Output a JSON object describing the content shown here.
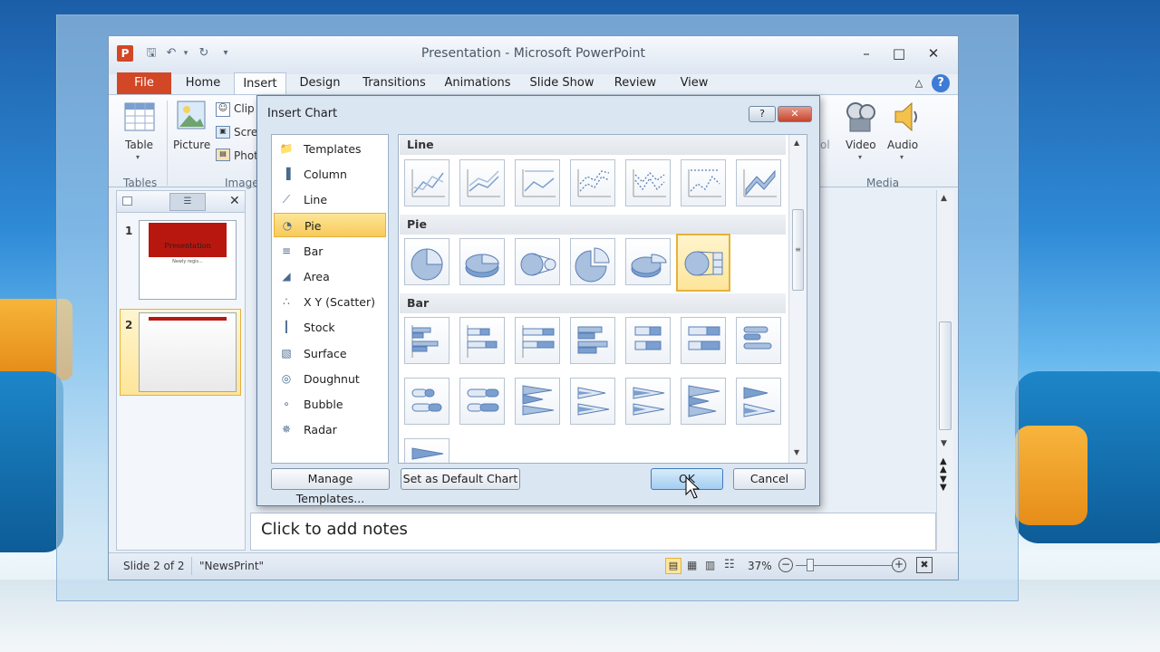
{
  "window": {
    "title": "Presentation  -  Microsoft PowerPoint",
    "app_letter": "P"
  },
  "tabs": [
    {
      "label": "File"
    },
    {
      "label": "Home"
    },
    {
      "label": "Insert"
    },
    {
      "label": "Design"
    },
    {
      "label": "Transitions"
    },
    {
      "label": "Animations"
    },
    {
      "label": "Slide Show"
    },
    {
      "label": "Review"
    },
    {
      "label": "View"
    }
  ],
  "ribbon": {
    "table": "Table",
    "picture": "Picture",
    "clip": "Clip",
    "screen": "Scre",
    "photo": "Phot",
    "group_tables": "Tables",
    "group_images": "Image",
    "partial_label": "ol",
    "video": "Video",
    "audio": "Audio",
    "group_media": "Media"
  },
  "slides": [
    {
      "number": "1",
      "title": "Presentation",
      "subtitle": "Newly regis..."
    },
    {
      "number": "2"
    }
  ],
  "notes": {
    "placeholder": "Click to add notes"
  },
  "status": {
    "slide": "Slide 2 of 2",
    "theme": "\"NewsPrint\"",
    "zoom": "37%"
  },
  "dialog": {
    "title": "Insert Chart",
    "help": "?",
    "categories": [
      {
        "label": "Templates"
      },
      {
        "label": "Column"
      },
      {
        "label": "Line"
      },
      {
        "label": "Pie"
      },
      {
        "label": "Bar"
      },
      {
        "label": "Area"
      },
      {
        "label": "X Y (Scatter)"
      },
      {
        "label": "Stock"
      },
      {
        "label": "Surface"
      },
      {
        "label": "Doughnut"
      },
      {
        "label": "Bubble"
      },
      {
        "label": "Radar"
      }
    ],
    "selected_category": "Pie",
    "sections": {
      "line": "Line",
      "pie": "Pie",
      "bar": "Bar"
    },
    "buttons": {
      "manage": "Manage Templates...",
      "default": "Set as Default Chart",
      "ok": "OK",
      "cancel": "Cancel"
    }
  },
  "colors": {
    "file_tab": "#d24726",
    "selection": "#f8c95a",
    "chart_blue": "#7b9fcf"
  }
}
